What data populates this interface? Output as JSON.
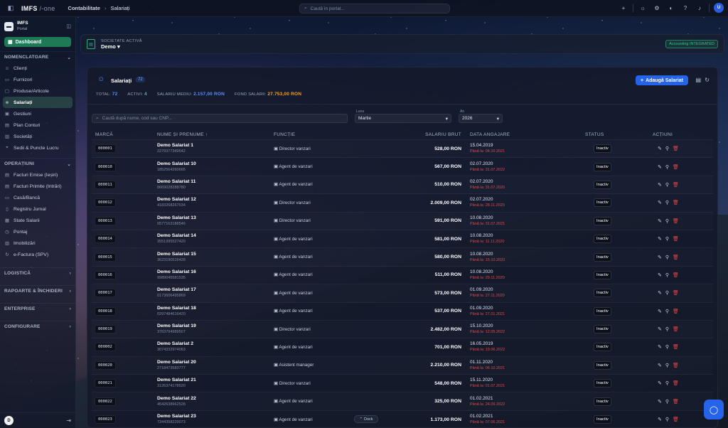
{
  "topbar": {
    "logo_main": "IMFS",
    "logo_sub": "/-one",
    "crumb_1": "Contabilitate",
    "crumb_sep": "›",
    "crumb_2": "Salariați",
    "search_placeholder": "Caută în portal...",
    "avatar_letter": "U"
  },
  "sidebar": {
    "brand": "IMFS",
    "brand_sub": "Portal",
    "dashboard": "Dashboard",
    "sections": [
      {
        "title": "NOMENCLATOARE",
        "items": [
          "Clienți",
          "Furnizori",
          "Produse/Articole",
          "Salariați",
          "Gestiuni",
          "Plan Conturi",
          "Societăți",
          "Sedii & Puncte Lucru"
        ]
      },
      {
        "title": "OPERAȚIUNI",
        "items": [
          "Facturi Emise (Ieșiri)",
          "Facturi Primite (Intrări)",
          "Casă/Bancă",
          "Registru Jurnal",
          "State Salarii",
          "Pontaj",
          "Imobilizări",
          "e-Factura (SPV)"
        ]
      },
      {
        "title": "LOGISTICĂ",
        "items": []
      },
      {
        "title": "RAPOARTE & ÎNCHIDERI",
        "items": []
      },
      {
        "title": "ENTERPRISE",
        "items": []
      },
      {
        "title": "CONFIGURARE",
        "items": []
      }
    ],
    "active_item": "Salariați",
    "footer_letter": "D"
  },
  "company": {
    "label": "SOCIETATE ACTIVĂ",
    "value": "Demo",
    "badge": "Accounting INTEGRATED"
  },
  "panel": {
    "title": "Salariați",
    "count": "72",
    "add_button": "Adaugă Salariat",
    "stats": {
      "total_label": "TOTAL:",
      "total": "72",
      "active_label": "ACTIVI:",
      "active": "4",
      "avg_label": "SALARIU MEDIU:",
      "avg": "2.157,00 RON",
      "fund_label": "FOND SALARII:",
      "fund": "27.753,00 RON"
    },
    "search_placeholder": "Caută după nume, cod sau CNP...",
    "month_label": "Luna",
    "month_value": "Martie",
    "year_label": "An",
    "year_value": "2026",
    "columns": [
      "MARCĂ",
      "NUME ȘI PRENUME",
      "FUNCȚIE",
      "SALARIU BRUT",
      "DATA ANGAJARE",
      "STATUS",
      "ACȚIUNI"
    ],
    "dock_label": "Dock"
  },
  "rows": [
    {
      "marca": "000001",
      "name": "Demo Salariat 1",
      "cnp": "2279377349542",
      "func": "Director vanzari",
      "sal": "528,00 RON",
      "date": "15.04.2019",
      "until": "Până la: 04.10.2021",
      "status": "Inactiv"
    },
    {
      "marca": "000010",
      "name": "Demo Salariat 10",
      "cnp": "1852564260665",
      "func": "Agent de vanzari",
      "sal": "567,00 RON",
      "date": "02.07.2020",
      "until": "Până la: 31.07.2022",
      "status": "Inactiv"
    },
    {
      "marca": "000011",
      "name": "Demo Salariat 11",
      "cnp": "8669028288780",
      "func": "Agent de vanzari",
      "sal": "510,00 RON",
      "date": "02.07.2020",
      "until": "Până la: 31.07.2020",
      "status": "Inactiv"
    },
    {
      "marca": "000012",
      "name": "Demo Salariat 12",
      "cnp": "4183268267634",
      "func": "Director vanzari",
      "sal": "2.009,00 RON",
      "date": "02.07.2020",
      "until": "Până la: 28.11.2020",
      "status": "Inactiv"
    },
    {
      "marca": "000013",
      "name": "Demo Salariat 13",
      "cnp": "0577163188546",
      "func": "Director vanzari",
      "sal": "591,00 RON",
      "date": "10.08.2020",
      "until": "Până la: 31.07.2021",
      "status": "Inactiv"
    },
    {
      "marca": "000014",
      "name": "Demo Salariat 14",
      "cnp": "3551995527420",
      "func": "Agent de vanzari",
      "sal": "581,00 RON",
      "date": "10.08.2020",
      "until": "Până la: 11.11.2020",
      "status": "Inactiv"
    },
    {
      "marca": "000015",
      "name": "Demo Salariat 15",
      "cnp": "3623190516428",
      "func": "Agent de vanzari",
      "sal": "580,00 RON",
      "date": "10.08.2020",
      "until": "Până la: 15.10.2020",
      "status": "Inactiv"
    },
    {
      "marca": "000016",
      "name": "Demo Salariat 16",
      "cnp": "9989045581535",
      "func": "Agent de vanzari",
      "sal": "511,00 RON",
      "date": "10.08.2020",
      "until": "Până la: 29.11.2020",
      "status": "Inactiv"
    },
    {
      "marca": "000017",
      "name": "Demo Salariat 17",
      "cnp": "0173606495869",
      "func": "Agent de vanzari",
      "sal": "573,00 RON",
      "date": "01.09.2020",
      "until": "Până la: 27.11.2020",
      "status": "Inactiv"
    },
    {
      "marca": "000018",
      "name": "Demo Salariat 18",
      "cnp": "0297484616420",
      "func": "Agent de vanzari",
      "sal": "537,00 RON",
      "date": "01.09.2020",
      "until": "Până la: 27.01.2021",
      "status": "Inactiv"
    },
    {
      "marca": "000019",
      "name": "Demo Salariat 19",
      "cnp": "3763794989507",
      "func": "Director vanzari",
      "sal": "2.482,00 RON",
      "date": "15.10.2020",
      "until": "Până la: 12.05.2022",
      "status": "Inactiv"
    },
    {
      "marca": "000002",
      "name": "Demo Salariat 2",
      "cnp": "3074332974063",
      "func": "Agent de vanzari",
      "sal": "701,00 RON",
      "date": "16.05.2019",
      "until": "Până la: 19.06.2022",
      "status": "Inactiv"
    },
    {
      "marca": "000020",
      "name": "Demo Salariat 20",
      "cnp": "2718473583777",
      "func": "Asistent manager",
      "sal": "2.210,00 RON",
      "date": "01.11.2020",
      "until": "Până la: 06.10.2021",
      "status": "Inactiv"
    },
    {
      "marca": "000021",
      "name": "Demo Salariat 21",
      "cnp": "3126374178520",
      "func": "Director vanzari",
      "sal": "548,00 RON",
      "date": "15.11.2020",
      "until": "Până la: 01.07.2021",
      "status": "Inactiv"
    },
    {
      "marca": "000022",
      "name": "Demo Salariat 22",
      "cnp": "4542638962528",
      "func": "Agent de vanzari",
      "sal": "325,00 RON",
      "date": "01.02.2021",
      "until": "Până la: 24.09.2022",
      "status": "Inactiv"
    },
    {
      "marca": "000023",
      "name": "Demo Salariat 23",
      "cnp": "7344358229073",
      "func": "Agent de vanzari",
      "sal": "1.173,00 RON",
      "date": "01.02.2021",
      "until": "Până la: 07.06.2021",
      "status": "Inactiv"
    }
  ]
}
